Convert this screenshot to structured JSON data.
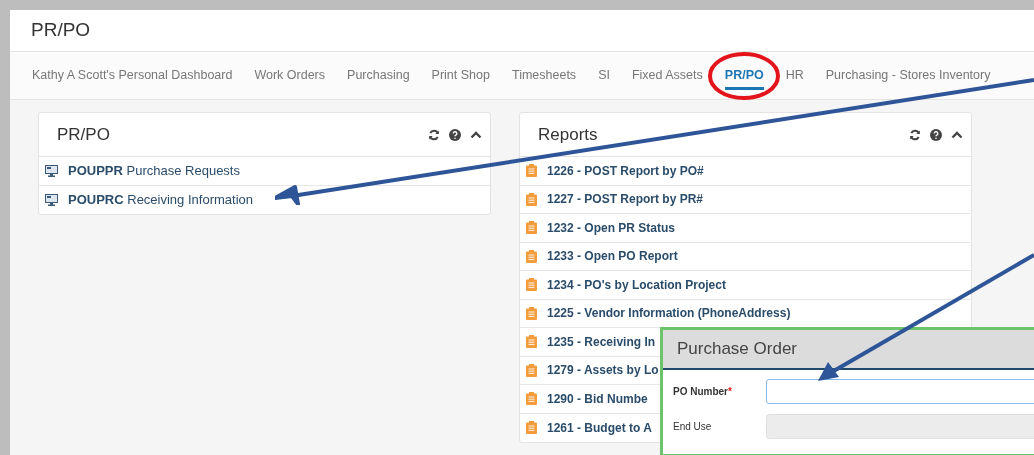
{
  "page_title": "PR/PO",
  "tabs": [
    {
      "label": "Kathy A Scott's Personal Dashboard",
      "selected": false
    },
    {
      "label": "Work Orders",
      "selected": false
    },
    {
      "label": "Purchasing",
      "selected": false
    },
    {
      "label": "Print Shop",
      "selected": false
    },
    {
      "label": "Timesheets",
      "selected": false
    },
    {
      "label": "SI",
      "selected": false
    },
    {
      "label": "Fixed Assets",
      "selected": false
    },
    {
      "label": "PR/PO",
      "selected": true
    },
    {
      "label": "HR",
      "selected": false
    },
    {
      "label": "Purchasing - Stores Inventory",
      "selected": false
    }
  ],
  "panels": [
    {
      "title": "PR/PO",
      "kind": "screens",
      "items": [
        {
          "code": "POUPPR",
          "label": "Purchase Requests"
        },
        {
          "code": "POUPRC",
          "label": "Receiving Information"
        }
      ]
    },
    {
      "title": "Reports",
      "kind": "reports",
      "items": [
        {
          "label": "1226 - POST Report by PO#"
        },
        {
          "label": "1227 - POST Report by PR#"
        },
        {
          "label": "1232 - Open PR Status"
        },
        {
          "label": "1233 - Open PO Report"
        },
        {
          "label": "1234 - PO's by Location Project"
        },
        {
          "label": "1225 - Vendor Information (PhoneAddress)"
        },
        {
          "label": "1235 - Receiving In"
        },
        {
          "label": "1279 - Assets by Lo"
        },
        {
          "label": "1290 - Bid Numbe"
        },
        {
          "label": "1261 - Budget to A"
        }
      ]
    }
  ],
  "dialog": {
    "title": "Purchase Order",
    "fields": [
      {
        "label": "PO Number",
        "required": true,
        "required_mark": "*",
        "disabled": false
      },
      {
        "label": "End Use",
        "required": false,
        "disabled": true
      }
    ]
  }
}
